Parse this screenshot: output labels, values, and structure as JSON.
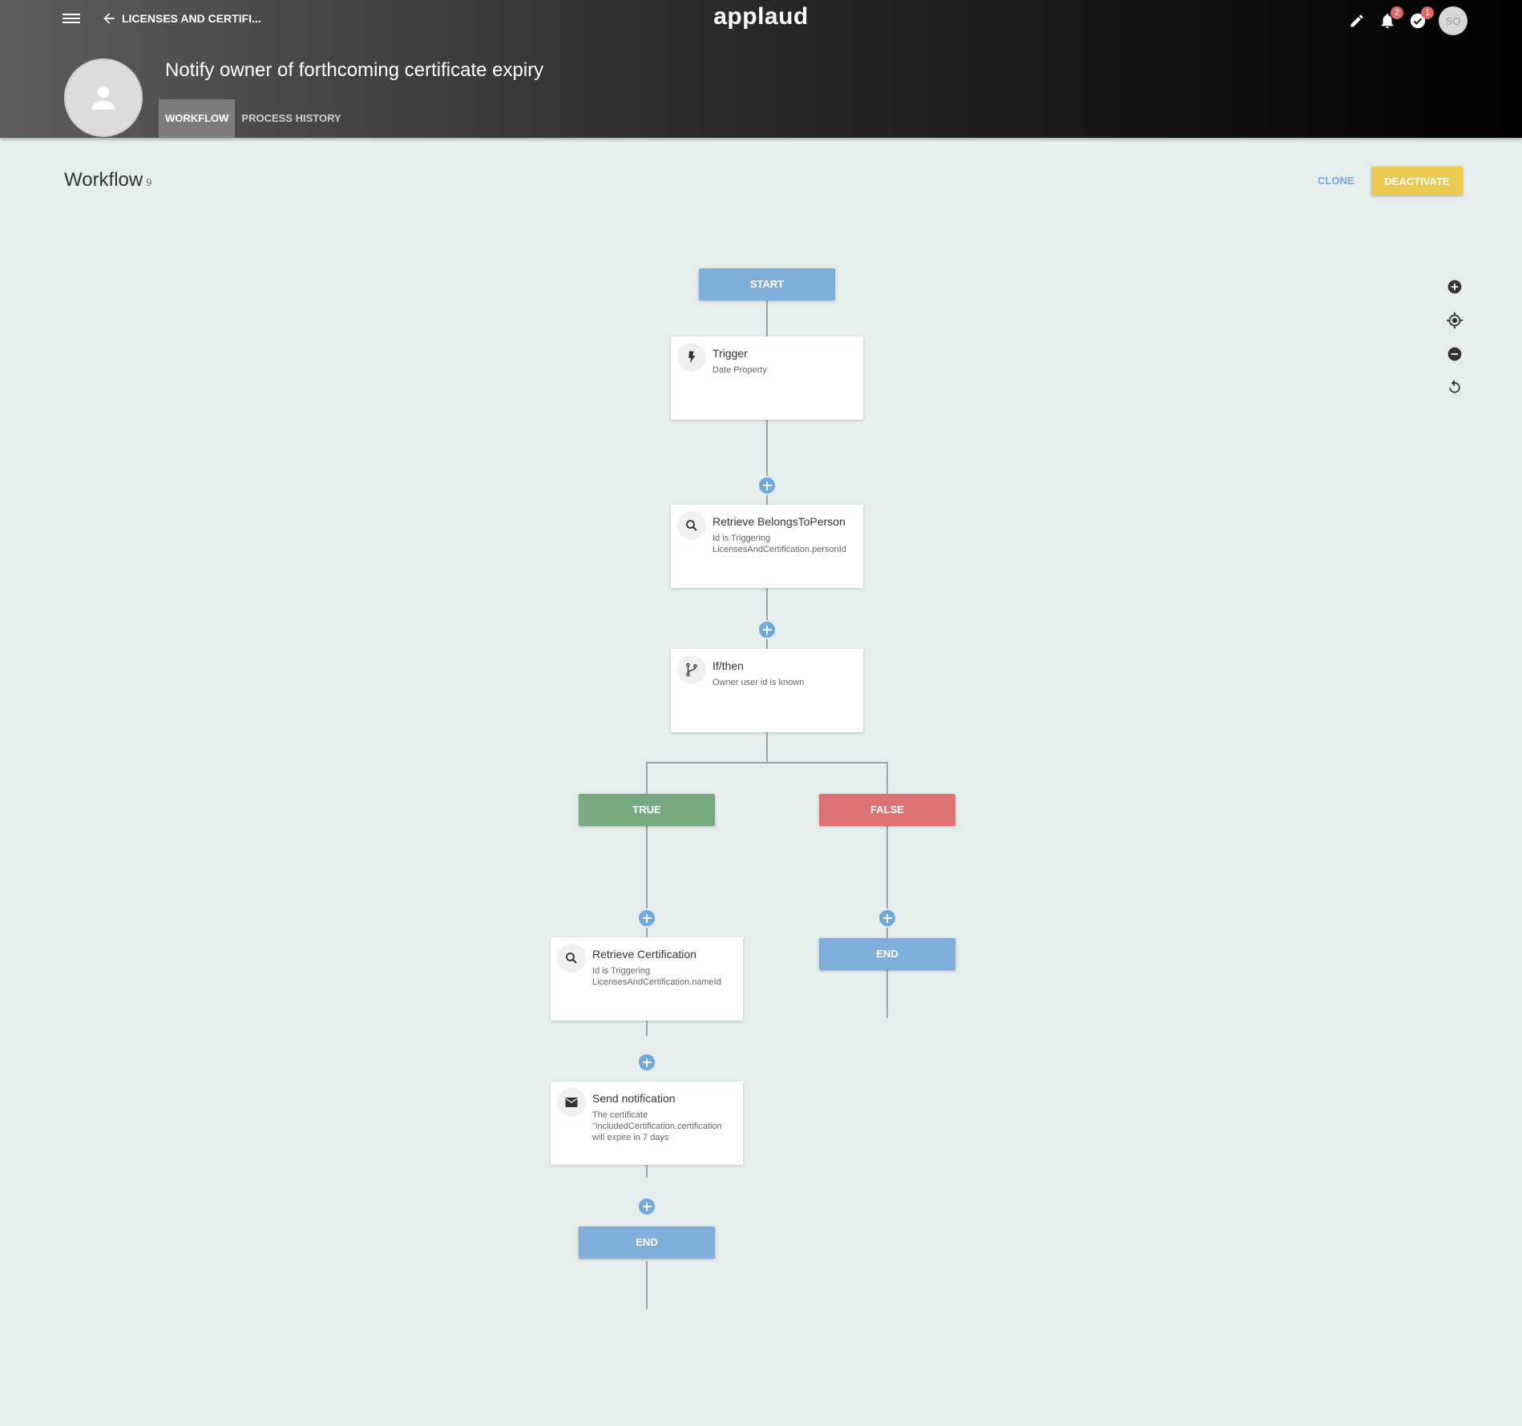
{
  "header": {
    "back_label": "LICENSES AND CERTIFI...",
    "brand": "applaud",
    "notifications_count": "2",
    "tasks_count": "1",
    "user_initials": "SO",
    "title": "Notify owner of forthcoming certificate expiry",
    "tabs": [
      {
        "label": "WORKFLOW",
        "active": true
      },
      {
        "label": "PROCESS HISTORY",
        "active": false
      }
    ]
  },
  "workflow": {
    "heading": "Workflow",
    "count": "9",
    "clone_label": "CLONE",
    "deactivate_label": "DEACTIVATE"
  },
  "colors": {
    "accent": "#6fa8dc",
    "start_end": "#80aedb",
    "true_branch": "#77aa80",
    "false_branch": "#de7171",
    "deactivate": "#e9c94f"
  },
  "zoom_controls": [
    "zoom-in-icon",
    "recenter-icon",
    "zoom-out-icon",
    "reset-icon"
  ],
  "flow": {
    "start": "START",
    "trigger": {
      "title": "Trigger",
      "subtitle": "Date Property",
      "icon": "bolt-icon"
    },
    "retrieve_person": {
      "title": "Retrieve BelongsToPerson",
      "subtitle": "Id is Triggering\nLicensesAndCertification.personId",
      "icon": "search-icon"
    },
    "ifthen": {
      "title": "If/then",
      "subtitle": "Owner user id is known",
      "icon": "branch-icon"
    },
    "true_label": "TRUE",
    "false_label": "FALSE",
    "retrieve_cert": {
      "title": "Retrieve Certification",
      "subtitle": "Id is Triggering\nLicensesAndCertification.nameId",
      "icon": "search-icon"
    },
    "send_notification": {
      "title": "Send notification",
      "subtitle": "The certificate\n\"includedCertification.certification\nwill expire in 7 days",
      "icon": "mail-icon"
    },
    "end_true": "END",
    "end_false": "END"
  }
}
